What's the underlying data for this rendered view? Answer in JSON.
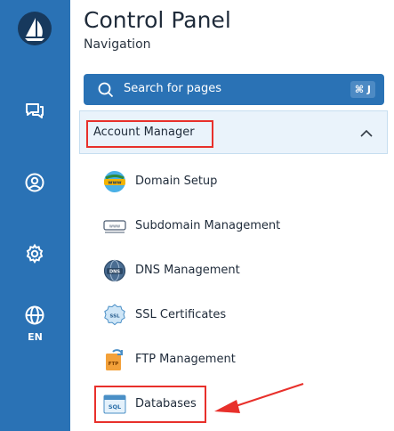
{
  "app": {
    "title": "Control Panel",
    "subtitle": "Navigation"
  },
  "rail": {
    "language": "EN",
    "icons": [
      "sailboat-logo-icon",
      "chat-icon",
      "user-circle-icon",
      "gear-icon",
      "globe-icon"
    ]
  },
  "search": {
    "placeholder": "Search for pages",
    "shortcut": "⌘ J"
  },
  "group": {
    "label": "Account Manager",
    "expanded": true
  },
  "items": [
    {
      "label": "Domain Setup",
      "icon": "www-globe-icon"
    },
    {
      "label": "Subdomain Management",
      "icon": "subdomain-icon"
    },
    {
      "label": "DNS Management",
      "icon": "dns-globe-icon"
    },
    {
      "label": "SSL Certificates",
      "icon": "ssl-badge-icon"
    },
    {
      "label": "FTP Management",
      "icon": "ftp-folder-icon"
    },
    {
      "label": "Databases",
      "icon": "sql-database-icon"
    }
  ],
  "colors": {
    "accent": "#2a72b5",
    "highlight": "#e8302b",
    "group_bg": "#eaf3fb"
  }
}
